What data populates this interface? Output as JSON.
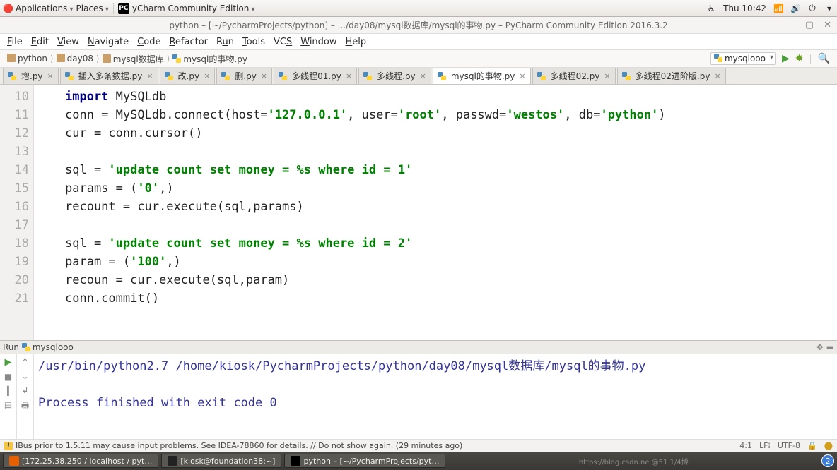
{
  "sysbar": {
    "apps": "Applications",
    "places": "Places",
    "app_icon": "PC",
    "app_name": "yCharm Community Edition",
    "clock": "Thu 10:42",
    "notif_count": "2"
  },
  "window": {
    "title": "python – [~/PycharmProjects/python] – .../day08/mysql数据库/mysql的事物.py – PyCharm Community Edition 2016.3.2",
    "min": "—",
    "max": "▢",
    "close": "✕"
  },
  "menu": [
    "File",
    "Edit",
    "View",
    "Navigate",
    "Code",
    "Refactor",
    "Run",
    "Tools",
    "VCS",
    "Window",
    "Help"
  ],
  "crumbs": [
    "python",
    "day08",
    "mysql数据库",
    "mysql的事物.py"
  ],
  "run_config": "mysqlooo",
  "tabs": [
    {
      "label": "增.py",
      "active": false
    },
    {
      "label": "插入多条数据.py",
      "active": false
    },
    {
      "label": "改.py",
      "active": false
    },
    {
      "label": "删.py",
      "active": false
    },
    {
      "label": "多线程01.py",
      "active": false
    },
    {
      "label": "多线程.py",
      "active": false
    },
    {
      "label": "mysql的事物.py",
      "active": true
    },
    {
      "label": "多线程02.py",
      "active": false
    },
    {
      "label": "多线程02进阶版.py",
      "active": false
    }
  ],
  "linestart": 10,
  "code": {
    "l10_a": "import",
    "l10_b": " MySQLdb",
    "l11": "conn = MySQLdb.connect(host=",
    "l11_s1": "'127.0.0.1'",
    "l11_m": ", user=",
    "l11_s2": "'root'",
    "l11_m2": ", passwd=",
    "l11_s3": "'westos'",
    "l11_m3": ", db=",
    "l11_s4": "'python'",
    "l11_e": ")",
    "l12": "cur = conn.cursor()",
    "l13": "",
    "l14": "sql = ",
    "l14_s": "'update count set money = %s where id = 1'",
    "l15": "params = (",
    "l15_s": "'0'",
    "l15_e": ",)",
    "l16": "recount = cur.execute(sql,params)",
    "l17": "",
    "l18": "sql = ",
    "l18_s": "'update count set money = %s where id = 2'",
    "l19": "param = (",
    "l19_s": "'100'",
    "l19_e": ",)",
    "l20": "recoun = cur.execute(sql,param)",
    "l21": "conn.commit()"
  },
  "run": {
    "header_label": "Run",
    "header_name": "mysqlooo",
    "out1": "/usr/bin/python2.7 /home/kiosk/PycharmProjects/python/day08/mysql数据库/mysql的事物.py",
    "out2": "",
    "out3": "Process finished with exit code 0"
  },
  "notice": {
    "icon": "!",
    "text": "IBus prior to 1.5.11 may cause input problems. See IDEA-78860 for details. // Do not show again. (29 minutes ago)",
    "pos": "4:1",
    "lf": "LF⁞",
    "enc": "UTF-8",
    "lock": "🔒",
    "insp": "⬤"
  },
  "task": {
    "b1": "[172.25.38.250 / localhost / pyt…",
    "b2": "[kiosk@foundation38:~]",
    "b3": "python – [~/PycharmProjects/pyt…"
  },
  "watermark": "https://blog.csdn.ne @51  1/4博"
}
